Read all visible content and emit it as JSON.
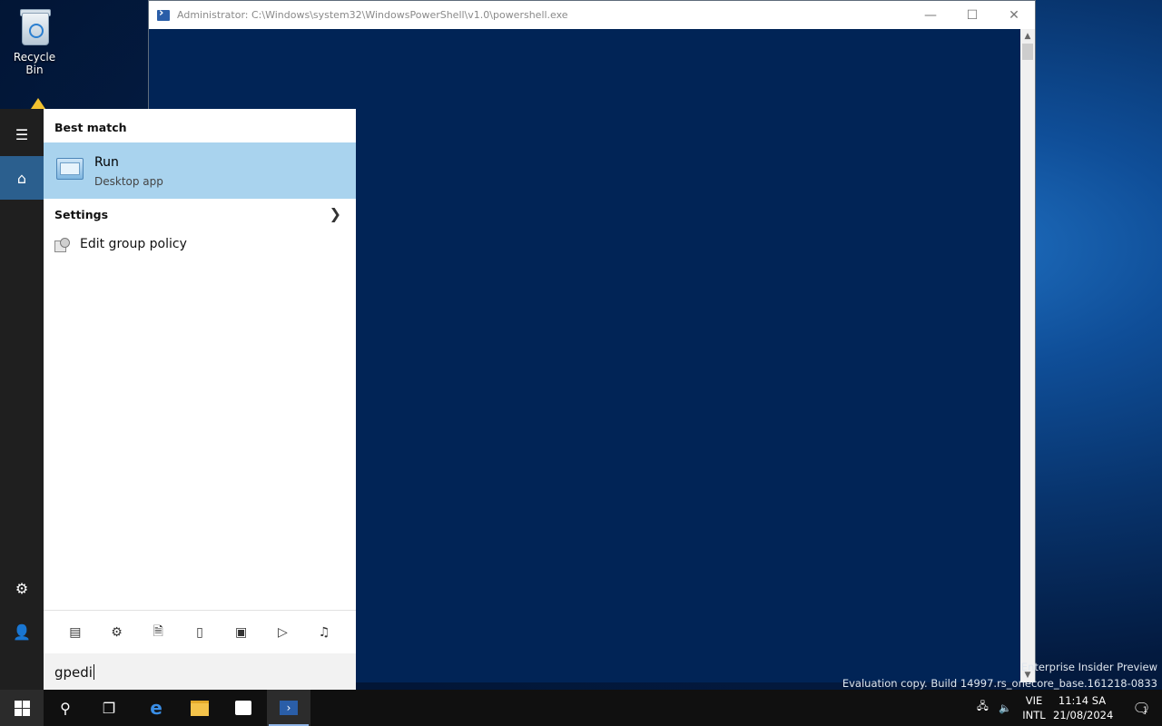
{
  "desktop": {
    "recycle_bin_label": "Recycle Bin"
  },
  "powershell": {
    "title": "Administrator: C:\\Windows\\system32\\WindowsPowerShell\\v1.0\\powershell.exe",
    "background_color": "#012456"
  },
  "watermark": {
    "line1": "Enterprise Insider Preview",
    "line2": "Evaluation copy. Build 14997.rs_onecore_base.161218-0833"
  },
  "start_rail": {
    "items": [
      "menu-icon",
      "home-icon",
      "settings-icon",
      "user-icon"
    ]
  },
  "search": {
    "best_match_heading": "Best match",
    "best_match": {
      "title": "Run",
      "subtitle": "Desktop app"
    },
    "settings_heading": "Settings",
    "settings_items": [
      {
        "label": "Edit group policy"
      }
    ],
    "filters": [
      "apps-icon",
      "settings-icon",
      "documents-icon",
      "folders-icon",
      "photos-icon",
      "videos-icon",
      "music-icon"
    ],
    "query": "gpedi"
  },
  "taskbar": {
    "apps": [
      "start-icon",
      "search-icon",
      "task-view-icon",
      "edge-icon",
      "file-explorer-icon",
      "store-icon",
      "powershell-icon"
    ],
    "language_top": "VIE",
    "language_bottom": "INTL",
    "time": "11:14 SA",
    "date": "21/08/2024",
    "notification_count": "1",
    "accent": "#2b5f8e"
  }
}
